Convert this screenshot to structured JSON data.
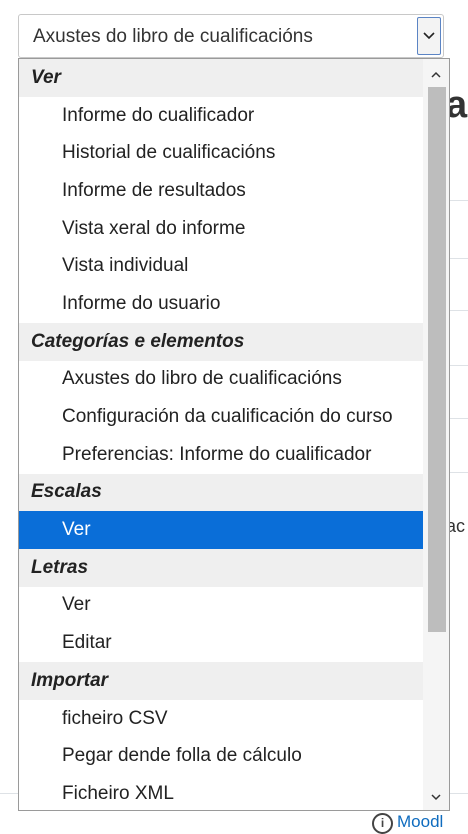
{
  "background": {
    "heading_fragment": "a",
    "text_fragment": "ac",
    "help_link": "Moodl"
  },
  "select": {
    "current_value": "Axustes do libro de cualificacións",
    "arrow_icon": "chevron-down-icon"
  },
  "dropdown": {
    "groups": [
      {
        "label": "Ver",
        "options": [
          "Informe do cualificador",
          "Historial de cualificacións",
          "Informe de resultados",
          "Vista xeral do informe",
          "Vista individual",
          "Informe do usuario"
        ]
      },
      {
        "label": "Categorías e elementos",
        "options": [
          "Axustes do libro de cualificacións",
          "Configuración da cualificación do curso",
          "Preferencias: Informe do cualificador"
        ]
      },
      {
        "label": "Escalas",
        "options": [
          "Ver"
        ]
      },
      {
        "label": "Letras",
        "options": [
          "Ver",
          "Editar"
        ]
      },
      {
        "label": "Importar",
        "options": [
          "ficheiro CSV",
          "Pegar dende folla de cálculo",
          "Ficheiro XML"
        ]
      }
    ],
    "selected": "Ver",
    "colors": {
      "selected_bg": "#0a6ed8",
      "group_bg": "#efefef"
    }
  }
}
